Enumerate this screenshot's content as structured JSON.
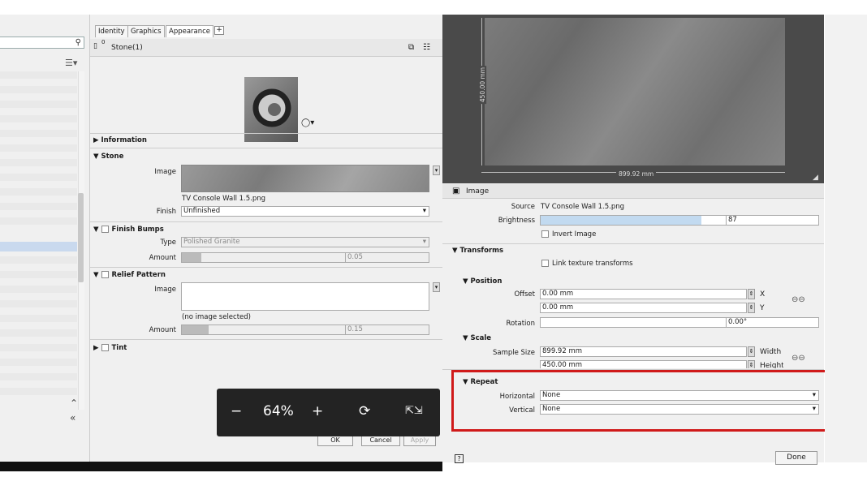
{
  "tabs": [
    "Identity",
    "Graphics",
    "Appearance",
    "+"
  ],
  "material": {
    "name": "Stone(1)",
    "count": "0"
  },
  "sections": {
    "information": "Information",
    "stone": "Stone",
    "finish_bumps": "Finish Bumps",
    "relief_pattern": "Relief Pattern",
    "tint": "Tint"
  },
  "stone": {
    "image_label": "Image",
    "image_file": "TV Console Wall 1.5.png",
    "finish_label": "Finish",
    "finish_value": "Unfinished"
  },
  "finish_bumps": {
    "type_label": "Type",
    "type_value": "Polished Granite",
    "amount_label": "Amount",
    "amount_value": "0.05",
    "amount_fraction": 0.05
  },
  "relief_pattern": {
    "image_label": "Image",
    "image_note": "(no image selected)",
    "amount_label": "Amount",
    "amount_value": "0.15",
    "amount_fraction": 0.15
  },
  "buttons": {
    "ok": "OK",
    "cancel": "Cancel",
    "apply": "Apply",
    "done": "Done",
    "help": "?"
  },
  "zoom": {
    "minus": "−",
    "value": "64%",
    "plus": "+",
    "rotate_icon": "rotate-icon",
    "fullscreen_icon": "fullscreen-icon"
  },
  "texture_preview": {
    "width_dim": "899.92 mm",
    "height_dim": "450.00 mm"
  },
  "image_panel": {
    "title": "Image",
    "source_label": "Source",
    "source_value": "TV Console Wall 1.5.png",
    "brightness_label": "Brightness",
    "brightness_value": "87",
    "brightness_fraction": 0.87,
    "invert_label": "Invert Image",
    "transforms": "Transforms",
    "link_label": "Link texture transforms",
    "position": "Position",
    "offset_label": "Offset",
    "offset_x": "0.00 mm",
    "offset_y": "0.00 mm",
    "x_label": "X",
    "y_label": "Y",
    "rotation_label": "Rotation",
    "rotation_value": "0.00°",
    "scale": "Scale",
    "sample_size_label": "Sample Size",
    "width_value": "899.92 mm",
    "height_value": "450.00 mm",
    "width_label": "Width",
    "height_label": "Height",
    "repeat": "Repeat",
    "horizontal_label": "Horizontal",
    "horizontal_value": "None",
    "vertical_label": "Vertical",
    "vertical_value": "None"
  },
  "colors": {
    "highlight": "#d01a1a",
    "zoom_bg": "#232323",
    "brightness_bar": "#c2daf0"
  }
}
